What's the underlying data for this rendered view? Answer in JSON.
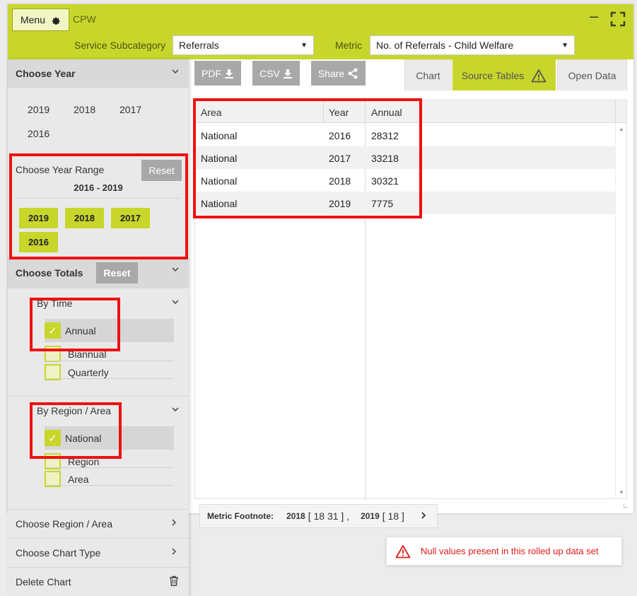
{
  "header": {
    "menu_label": "Menu",
    "app_name": "CPW",
    "service_subcategory_label": "Service Subcategory",
    "service_subcategory_value": "Referrals",
    "metric_label": "Metric",
    "metric_value": "No. of Referrals - Child Welfare"
  },
  "sidebar": {
    "choose_year": {
      "title": "Choose Year",
      "years": [
        "2019",
        "2018",
        "2017",
        "2016"
      ]
    },
    "year_range": {
      "title": "Choose Year Range",
      "reset_label": "Reset",
      "range": "2016 - 2019",
      "chips": [
        "2019",
        "2018",
        "2017",
        "2016"
      ]
    },
    "totals": {
      "title": "Choose Totals",
      "reset_label": "Reset",
      "by_time": {
        "title": "By Time",
        "options": [
          {
            "label": "Annual",
            "checked": true
          },
          {
            "label": "Biannual",
            "checked": false
          },
          {
            "label": "Quarterly",
            "checked": false
          }
        ]
      },
      "by_region": {
        "title": "By Region / Area",
        "options": [
          {
            "label": "National",
            "checked": true
          },
          {
            "label": "Region",
            "checked": false
          },
          {
            "label": "Area",
            "checked": false
          }
        ]
      }
    },
    "nav": {
      "region_area": "Choose Region / Area",
      "chart_type": "Choose Chart Type",
      "delete_chart": "Delete Chart"
    }
  },
  "toolbar": {
    "pdf_label": "PDF",
    "csv_label": "CSV",
    "share_label": "Share"
  },
  "tabs": {
    "chart": "Chart",
    "source_tables": "Source Tables",
    "open_data": "Open Data"
  },
  "table": {
    "headers": [
      "Area",
      "Year",
      "Annual"
    ],
    "rows": [
      [
        "National",
        "2016",
        "28312"
      ],
      [
        "National",
        "2017",
        "33218"
      ],
      [
        "National",
        "2018",
        "30321"
      ],
      [
        "National",
        "2019",
        "7775"
      ]
    ]
  },
  "footnote": {
    "label": "Metric Footnote:",
    "y1": "2018",
    "y1_refs": "[ 18  31 ] ,",
    "y2": "2019",
    "y2_refs": "[ 18 ]"
  },
  "alert": {
    "message": "Null values present in this rolled up data set"
  },
  "colors": {
    "accent": "#c8d62b",
    "highlight_red": "#ee1111",
    "alert_red": "#e21a1a"
  }
}
